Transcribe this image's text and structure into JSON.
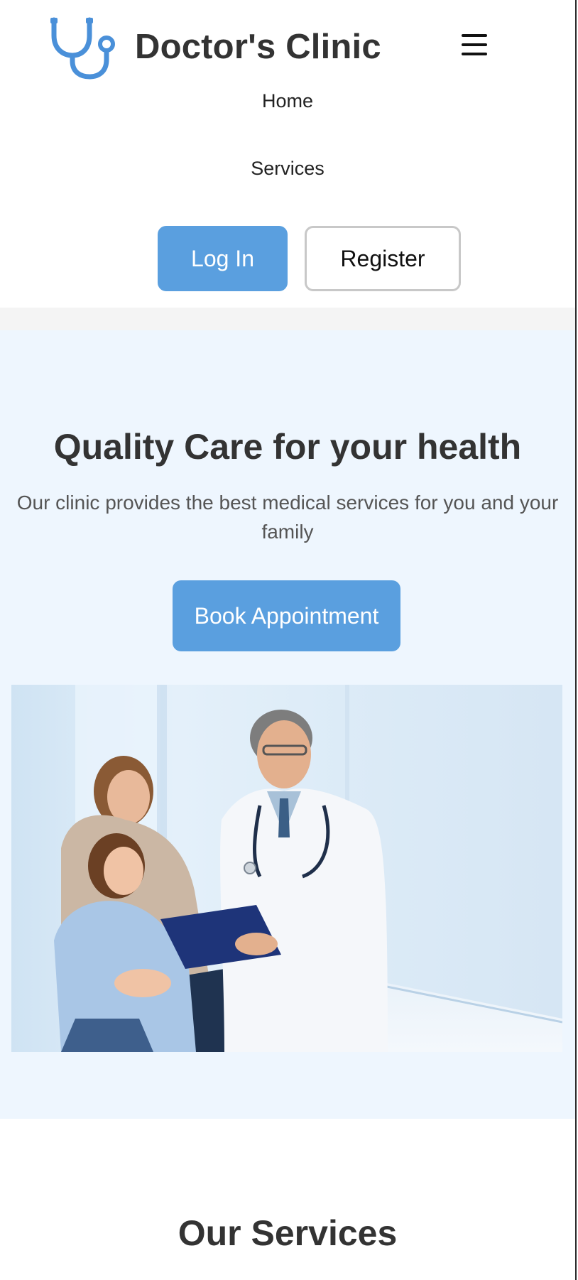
{
  "brand": {
    "name": "Doctor's Clinic",
    "logo_icon": "stethoscope-icon",
    "accent_color": "#5a9fdf"
  },
  "header": {
    "menu_icon": "hamburger-menu-icon"
  },
  "nav": {
    "items": [
      {
        "label": "Home"
      },
      {
        "label": "Services"
      }
    ]
  },
  "auth": {
    "login_label": "Log In",
    "register_label": "Register"
  },
  "hero": {
    "title": "Quality Care for your health",
    "subtitle": "Our clinic provides the best medical services for you and your family",
    "cta_label": "Book Appointment",
    "image": "doctor-with-mother-and-daughter-photo"
  },
  "services": {
    "title": "Our Services"
  }
}
